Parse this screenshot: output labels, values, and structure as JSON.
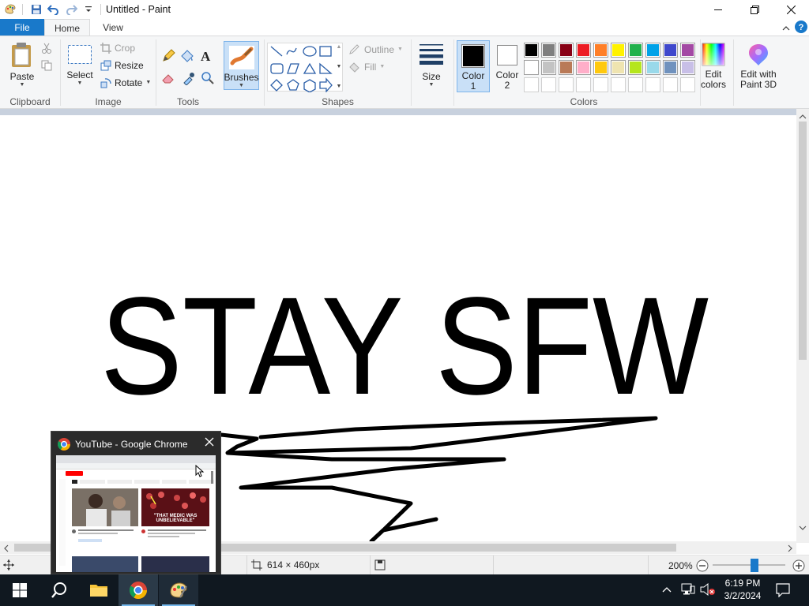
{
  "window": {
    "title": "Untitled - Paint"
  },
  "tabs": {
    "file": "File",
    "home": "Home",
    "view": "View"
  },
  "clipboard": {
    "paste": "Paste",
    "label": "Clipboard"
  },
  "image": {
    "select": "Select",
    "crop": "Crop",
    "resize": "Resize",
    "rotate": "Rotate",
    "label": "Image"
  },
  "tools": {
    "label": "Tools"
  },
  "brushes": {
    "label": "Brushes"
  },
  "shapes": {
    "outline": "Outline",
    "fill": "Fill",
    "label": "Shapes"
  },
  "size": {
    "label": "Size"
  },
  "colors": {
    "color1_line1": "Color",
    "color1_line2": "1",
    "color2_line1": "Color",
    "color2_line2": "2",
    "edit_line1": "Edit",
    "edit_line2": "colors",
    "paint3d_line1": "Edit with",
    "paint3d_line2": "Paint 3D",
    "label": "Colors",
    "color1_value": "#000000",
    "color2_value": "#ffffff",
    "palette_row1": [
      "#000000",
      "#7f7f7f",
      "#880015",
      "#ed1c24",
      "#ff7f27",
      "#fff200",
      "#22b14c",
      "#00a2e8",
      "#3f48cc",
      "#a349a4"
    ],
    "palette_row2": [
      "#ffffff",
      "#c3c3c3",
      "#b97a57",
      "#ffaec9",
      "#ffc90e",
      "#efe4b0",
      "#b5e61d",
      "#99d9ea",
      "#7092be",
      "#c8bfe7"
    ]
  },
  "canvas": {
    "text": "STAY SFW"
  },
  "statusbar": {
    "dimensions": "614 × 460px",
    "zoom": "200%"
  },
  "preview": {
    "title": "YouTube - Google Chrome",
    "thumb_caption_1": "\"THAT MEDIC WAS",
    "thumb_caption_2": "UNBELIEVABLE\""
  },
  "taskbar": {
    "time": "6:19 PM",
    "date": "3/2/2024"
  }
}
